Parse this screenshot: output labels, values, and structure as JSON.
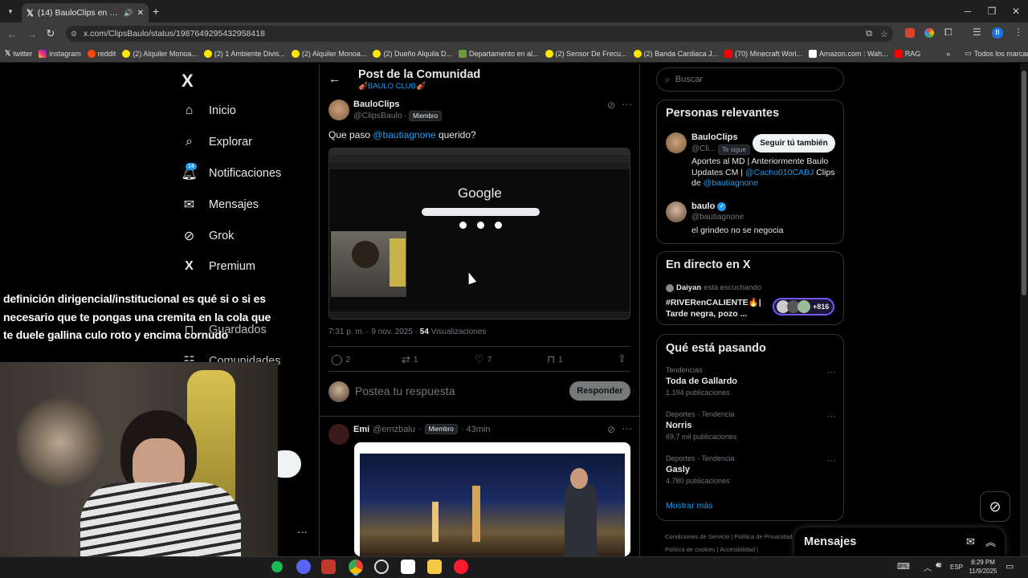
{
  "browser": {
    "tab_title": "(14) BauloClips en X: \"Que p",
    "url": "x.com/ClipsBaulo/status/1987649295432958418",
    "bookmarks": [
      "twitter",
      "instagram",
      "reddit",
      "(2) Alquiler Monoa...",
      "(2) 1 Ambiente Divis...",
      "(2) Alquiler Monoa...",
      "(2) Dueño Alquila D...",
      "Departamento en al...",
      "(2) Sensor De Frecu...",
      "(2) Banda Cardiaca J...",
      "(70) Minecraft Worl...",
      "Amazon.com : Wah...",
      "RAG"
    ],
    "all_bookmarks": "Todos los marcadores",
    "more": "»"
  },
  "sidebar": {
    "logo": "X",
    "items": [
      "Inicio",
      "Explorar",
      "Notificaciones",
      "Mensajes",
      "Grok",
      "Premium"
    ],
    "notif_count": "14",
    "hidden_items": [
      "Guardados",
      "Comunidades"
    ],
    "more": "···"
  },
  "header": {
    "title": "Post de la Comunidad",
    "community": "🎻BAULO CLUB🎻"
  },
  "post": {
    "name": "BauloClips",
    "handle": "@ClipsBaulo",
    "sep": "·",
    "badge": "Miembro",
    "text_before": "Que paso ",
    "mention": "@bautiagnone",
    "text_after": " querido?",
    "image_text": "Google",
    "meta_time": "7:31 p. m. · 9 nov. 2025 · ",
    "views": "54",
    "views_label": " Visualizaciones",
    "replies": "2",
    "reposts": "1",
    "likes": "7",
    "bookmarks": "1",
    "reply_placeholder": "Postea tu respuesta",
    "reply_button": "Responder"
  },
  "reply": {
    "name": "Emi",
    "handle": "@emzbalu",
    "sep": "·",
    "badge": "Miembro",
    "time": "· 43min"
  },
  "search": {
    "placeholder": "Buscar"
  },
  "relevant": {
    "title": "Personas relevantes",
    "p1": {
      "name": "BauloClips",
      "handle": "@Cli...",
      "follows": "Te sigue",
      "button": "Seguir tú también",
      "bio_1": "Aportes al MD | Anteriormente Baulo Updates CM | ",
      "bio_mention_1": "@Cacho010CABJ",
      "bio_2": " Clips de ",
      "bio_mention_2": "@bautiagnone"
    },
    "p2": {
      "name": "baulo",
      "handle": "@bautiagnone",
      "bio": "el grindeo no se negocia"
    }
  },
  "live": {
    "title": "En directo en X",
    "user": "Daiyan",
    "status": " está escuchando",
    "topic_1": "#RIVERenCALIENTE🔥|",
    "topic_2": "Tarde negra, pozo ...",
    "count": "+816"
  },
  "trends": {
    "title": "Qué está pasando",
    "items": [
      {
        "cat": "Tendencias",
        "name": "Toda de Gallardo",
        "count": "1.194 publicaciones"
      },
      {
        "cat": "Deportes · Tendencia",
        "name": "Norris",
        "count": "69,7 mil publicaciones"
      },
      {
        "cat": "Deportes · Tendencia",
        "name": "Gasly",
        "count": "4.780 publicaciones"
      }
    ],
    "more": "Mostrar más"
  },
  "footer": {
    "links": [
      "Condiciones de Servicio",
      "|",
      "Política de Privacidad",
      "Política de cookies",
      "|",
      "Accesibilidad",
      "|"
    ]
  },
  "messages": {
    "title": "Mensajes"
  },
  "overlay": {
    "text": "definición dirigencial/institucional es qué si o si es necesario que te pongas una cremita en la cola que te duele gallina culo roto y encima cornudo"
  },
  "taskbar": {
    "lang": "ESP",
    "time": "8:29 PM",
    "date": "11/9/2025"
  },
  "colors": {
    "accent": "#1d9bf0",
    "bg": "#000000",
    "border": "#2f3336",
    "muted": "#71767b"
  }
}
